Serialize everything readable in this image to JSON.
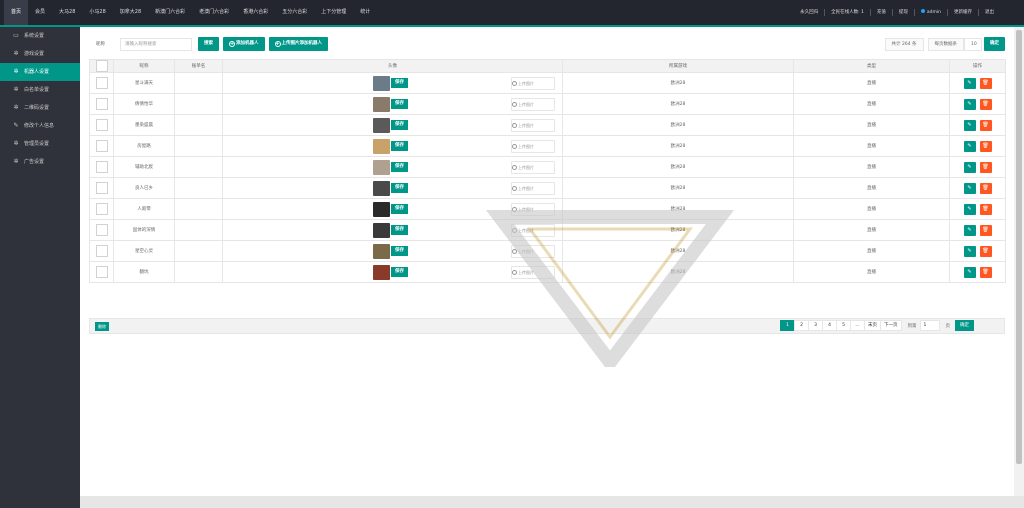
{
  "topnav": [
    "首页",
    "会员",
    "大马28",
    "小马28",
    "加拿大28",
    "新澳门六合彩",
    "老澳门六合彩",
    "香港六合彩",
    "五分六合彩",
    "上下分管理",
    "统计"
  ],
  "topright": {
    "forever": "永久回归",
    "online": "全民在线人数: 1",
    "recharge": "充值",
    "withdraw": "提现",
    "user": "admin",
    "cache": "更新缓存",
    "logout": "退出"
  },
  "sidebar": [
    {
      "label": "系统设置",
      "icon": "monitor-icon"
    },
    {
      "label": "游戏设置",
      "icon": "gear-icon"
    },
    {
      "label": "机器人设置",
      "icon": "gear-icon",
      "active": true
    },
    {
      "label": "白名单设置",
      "icon": "gear-icon"
    },
    {
      "label": "二维码设置",
      "icon": "gear-icon"
    },
    {
      "label": "修改个人信息",
      "icon": "pencil-icon"
    },
    {
      "label": "管理员设置",
      "icon": "gear-icon"
    },
    {
      "label": "广告设置",
      "icon": "gear-icon"
    }
  ],
  "toolbar": {
    "name_label": "昵称",
    "name_placeholder": "请输入昵称搜索",
    "search": "搜索",
    "add": "添加机器人",
    "upload_add": "上传图片添加机器人",
    "total": "共计 264 条",
    "per_page_label": "每页数据条",
    "per_page": "10",
    "confirm": "确定"
  },
  "table": {
    "headers": [
      "昵称",
      "账单名",
      "头像",
      "所属游戏",
      "类型",
      "操作"
    ],
    "save_label": "保存",
    "upload_label": "上传图片",
    "rows": [
      {
        "name": "星斗满天",
        "game": "欧洲28",
        "type": "直播",
        "avatar_color": "#6b7b8a"
      },
      {
        "name": "倩倩怡华",
        "game": "欧洲28",
        "type": "直播",
        "avatar_color": "#8a7a6a"
      },
      {
        "name": "墨染盛晨",
        "game": "欧洲28",
        "type": "直播",
        "avatar_color": "#5a5a5a"
      },
      {
        "name": "房屋路",
        "game": "欧洲28",
        "type": "直播",
        "avatar_color": "#c9a26a"
      },
      {
        "name": "辅助北宸",
        "game": "欧洲28",
        "type": "直播",
        "avatar_color": "#b0a090"
      },
      {
        "name": "良人已乡",
        "game": "欧洲28",
        "type": "直播",
        "avatar_color": "#4a4a4a"
      },
      {
        "name": "人叙零",
        "game": "欧洲28",
        "type": "直播",
        "avatar_color": "#2a2a2a"
      },
      {
        "name": "固体的深情",
        "game": "欧洲28",
        "type": "直播",
        "avatar_color": "#3a3a3a"
      },
      {
        "name": "星空心灵",
        "game": "欧洲28",
        "type": "直播",
        "avatar_color": "#7a6a4a"
      },
      {
        "name": "翻坑",
        "game": "欧洲28",
        "type": "直播",
        "avatar_color": "#8a3a2a"
      }
    ]
  },
  "footer": {
    "delete": "删除",
    "pages": [
      "1",
      "2",
      "3",
      "4",
      "5",
      "...",
      "末页",
      "下一页"
    ],
    "goto": "到第",
    "page_input": "1",
    "page_unit": "页",
    "ok": "确定"
  }
}
